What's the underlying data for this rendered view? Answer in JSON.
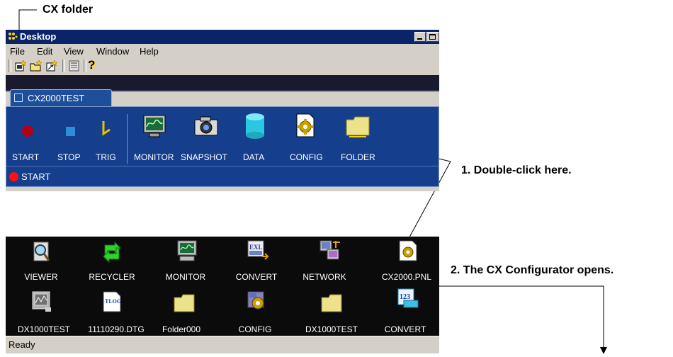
{
  "callouts": {
    "cx_folder": "CX folder",
    "step1": "1. Double-click here.",
    "step2": "2. The CX Configurator opens."
  },
  "window_top": {
    "title": "Desktop",
    "menu": [
      "File",
      "Edit",
      "View",
      "Window",
      "Help"
    ],
    "tab_label": "CX2000TEST",
    "tools": [
      {
        "label": "START",
        "icon": "start-record-icon"
      },
      {
        "label": "STOP",
        "icon": "stop-icon"
      },
      {
        "label": "TRIG",
        "icon": "trigger-icon"
      },
      {
        "label": "MONITOR",
        "icon": "monitor-icon"
      },
      {
        "label": "SNAPSHOT",
        "icon": "camera-icon"
      },
      {
        "label": "DATA",
        "icon": "data-cylinder-icon"
      },
      {
        "label": "CONFIG",
        "icon": "config-gear-icon"
      },
      {
        "label": "FOLDER",
        "icon": "folder-icon"
      }
    ],
    "status_label": "START"
  },
  "window_bottom": {
    "icons_row1": [
      {
        "label": "VIEWER",
        "icon": "viewer-icon"
      },
      {
        "label": "RECYCLER",
        "icon": "recycler-icon"
      },
      {
        "label": "MONITOR",
        "icon": "monitor-icon"
      },
      {
        "label": "CONVERT",
        "icon": "convert-excel-icon"
      },
      {
        "label": "NETWORK",
        "icon": "network-icon"
      },
      {
        "label": "CX2000.PNL",
        "icon": "config-gear-file-icon"
      }
    ],
    "icons_row2": [
      {
        "label": "DX1000TEST",
        "icon": "dx-device-icon"
      },
      {
        "label": "11110290.DTG",
        "icon": "tlog-file-icon"
      },
      {
        "label": "Folder000",
        "icon": "folder-icon"
      },
      {
        "label": "CONFIG",
        "icon": "config-icon"
      },
      {
        "label": "DX1000TEST",
        "icon": "folder-icon"
      },
      {
        "label": "CONVERT",
        "icon": "convert-123-icon"
      }
    ],
    "status": "Ready"
  },
  "colors": {
    "title_bar": "#0a246a",
    "panel": "#153f8c",
    "desktop_bg": "#0b0b0b"
  }
}
